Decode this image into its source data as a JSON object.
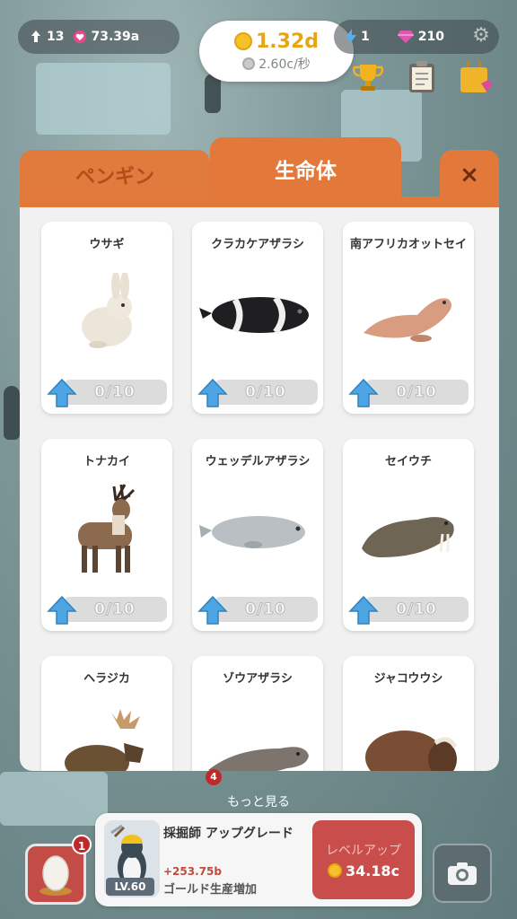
{
  "hud": {
    "population": "13",
    "hearts": "73.39a",
    "coins_total": "1.32d",
    "coins_rate": "2.60c/秒",
    "energy": "1",
    "gems": "210"
  },
  "icons": {
    "population": "penguin-icon",
    "hearts": "heart-gem-icon",
    "energy": "lightning-icon",
    "gems": "diamond-icon",
    "settings": "gear-icon",
    "trophy": "trophy-icon",
    "clipboard": "clipboard-icon",
    "shop": "shop-bag-icon"
  },
  "panel": {
    "tabs": [
      {
        "label": "ペンギン",
        "active": false
      },
      {
        "label": "生命体",
        "active": true
      }
    ],
    "close_label": "×",
    "cards": [
      {
        "name": "ウサギ",
        "progress": "0/10",
        "fill": 0,
        "art": "rabbit"
      },
      {
        "name": "クラカケアザラシ",
        "progress": "0/10",
        "fill": 0,
        "art": "ribbon-seal"
      },
      {
        "name": "南アフリカオットセイ",
        "progress": "0/10",
        "fill": 0,
        "art": "fur-seal"
      },
      {
        "name": "トナカイ",
        "progress": "0/10",
        "fill": 0,
        "art": "reindeer"
      },
      {
        "name": "ウェッデルアザラシ",
        "progress": "0/10",
        "fill": 0,
        "art": "weddell-seal"
      },
      {
        "name": "セイウチ",
        "progress": "0/10",
        "fill": 0,
        "art": "walrus"
      },
      {
        "name": "ヘラジカ",
        "progress": "",
        "fill": 0,
        "art": "moose"
      },
      {
        "name": "ゾウアザラシ",
        "progress": "",
        "fill": 0,
        "art": "elephant-seal"
      },
      {
        "name": "ジャコウウシ",
        "progress": "",
        "fill": 0,
        "art": "musk-ox"
      }
    ]
  },
  "more": {
    "badge": "4",
    "label": "もっと見る"
  },
  "bottom": {
    "egg_badge": "1",
    "upgrade_title": "採掘師 アップグレード",
    "level": "LV.60",
    "delta": "+253.75b",
    "description": "ゴールド生産増加",
    "levelup_label": "レベルアップ",
    "levelup_cost": "34.18c"
  },
  "colors": {
    "tab_orange": "#e2783a",
    "progress_blue": "#49a7e0",
    "coin_gold": "#f5c02a",
    "levelup_red": "#c94d4b"
  }
}
